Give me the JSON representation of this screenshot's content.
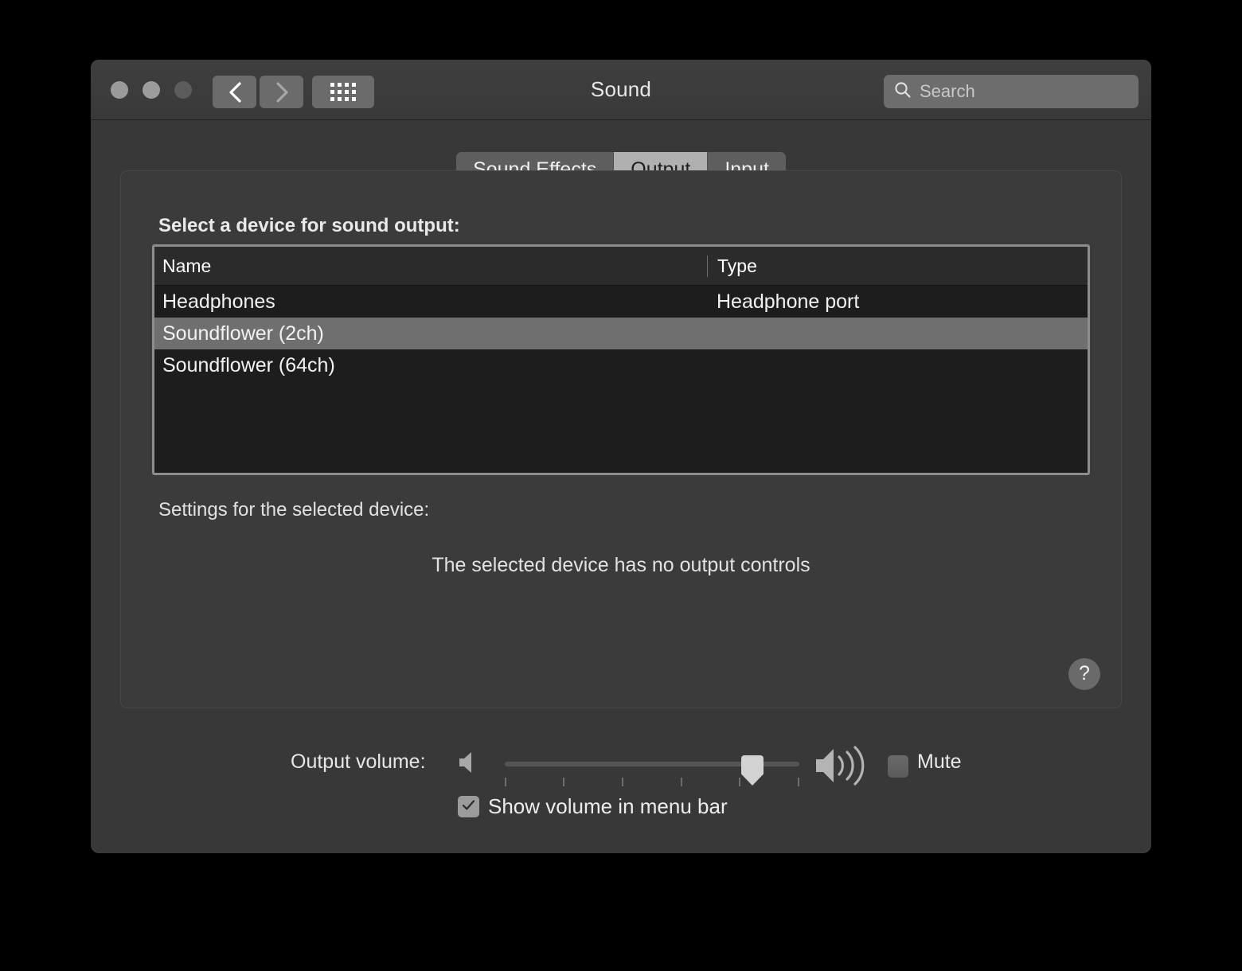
{
  "window": {
    "title": "Sound",
    "traffic_lights": [
      "close",
      "minimize",
      "maximize"
    ]
  },
  "toolbar": {
    "back_label": "Back",
    "forward_label": "Forward",
    "show_all_label": "Show All",
    "search": {
      "placeholder": "Search",
      "value": ""
    }
  },
  "tabs": [
    {
      "label": "Sound Effects",
      "active": false
    },
    {
      "label": "Output",
      "active": true
    },
    {
      "label": "Input",
      "active": false
    }
  ],
  "main": {
    "select_device_label": "Select a device for sound output:",
    "table": {
      "columns": [
        "Name",
        "Type"
      ],
      "rows": [
        {
          "name": "Headphones",
          "type": "Headphone port",
          "selected": false
        },
        {
          "name": "Soundflower (2ch)",
          "type": "",
          "selected": true
        },
        {
          "name": "Soundflower (64ch)",
          "type": "",
          "selected": false
        }
      ]
    },
    "settings_label": "Settings for the selected device:",
    "settings_message": "The selected device has no output controls",
    "help_label": "?"
  },
  "volume": {
    "label": "Output volume:",
    "slider_value_percent": 84,
    "tick_count": 6,
    "low_icon": "speaker-low-icon",
    "high_icon": "speaker-high-icon",
    "mute_label": "Mute",
    "mute_checked": false,
    "show_in_menu_bar_label": "Show volume in menu bar",
    "show_in_menu_bar_checked": true
  },
  "colors": {
    "window_bg": "#383838",
    "panel_bg": "#3b3b3b",
    "table_bg": "#1d1d1d",
    "row_selected": "#6f6f6f",
    "tab_active_bg": "#b0b0b0",
    "text_primary": "#f2f2f2"
  }
}
